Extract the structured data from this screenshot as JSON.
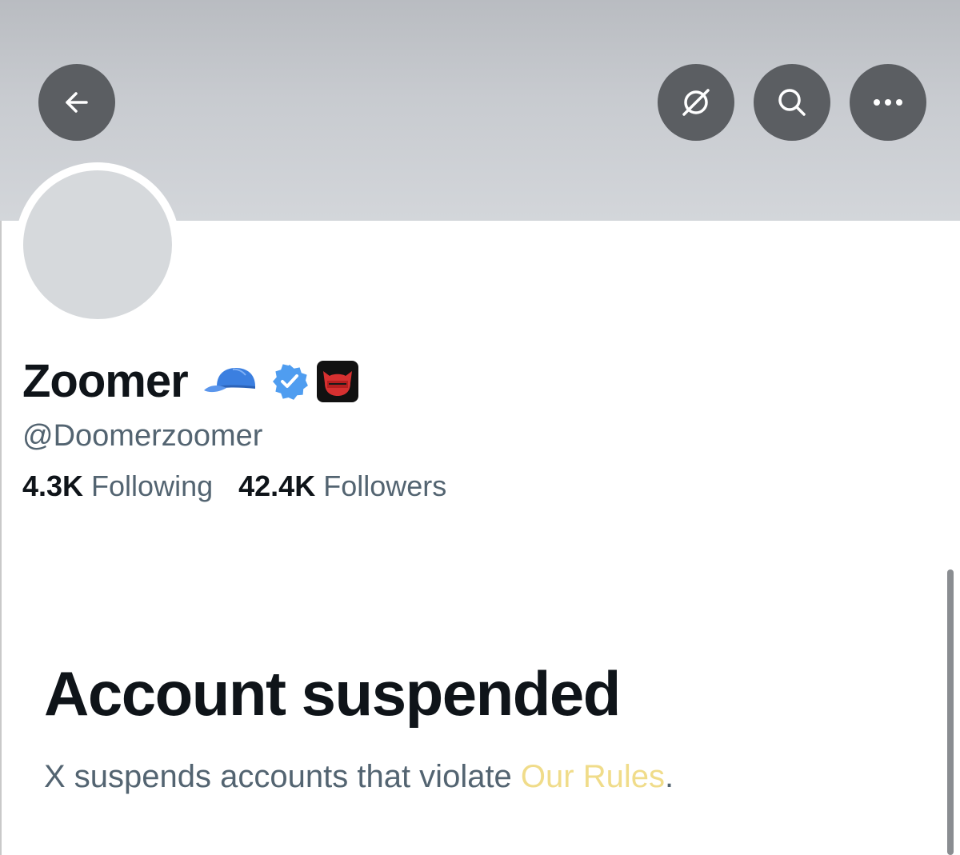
{
  "colors": {
    "banner": "#c5c8cc",
    "button_bg": "#5b5e62",
    "text_primary": "#0f1419",
    "text_secondary": "#536471",
    "verified_blue": "#4f9df0",
    "link": "#f0dc8a"
  },
  "header": {
    "back_icon": "arrow-left-icon",
    "actions": [
      {
        "icon": "grok-icon"
      },
      {
        "icon": "search-icon"
      },
      {
        "icon": "more-icon"
      }
    ]
  },
  "profile": {
    "display_name": "Zoomer",
    "badges": [
      "blue-cap-icon",
      "verified-badge-icon",
      "affiliate-badge-icon"
    ],
    "handle": "@Doomerzoomer",
    "following_count": "4.3K",
    "following_label": "Following",
    "followers_count": "42.4K",
    "followers_label": "Followers"
  },
  "suspension": {
    "title": "Account suspended",
    "description_prefix": "X suspends accounts that violate ",
    "link_text": "Our Rules",
    "description_suffix": "."
  }
}
